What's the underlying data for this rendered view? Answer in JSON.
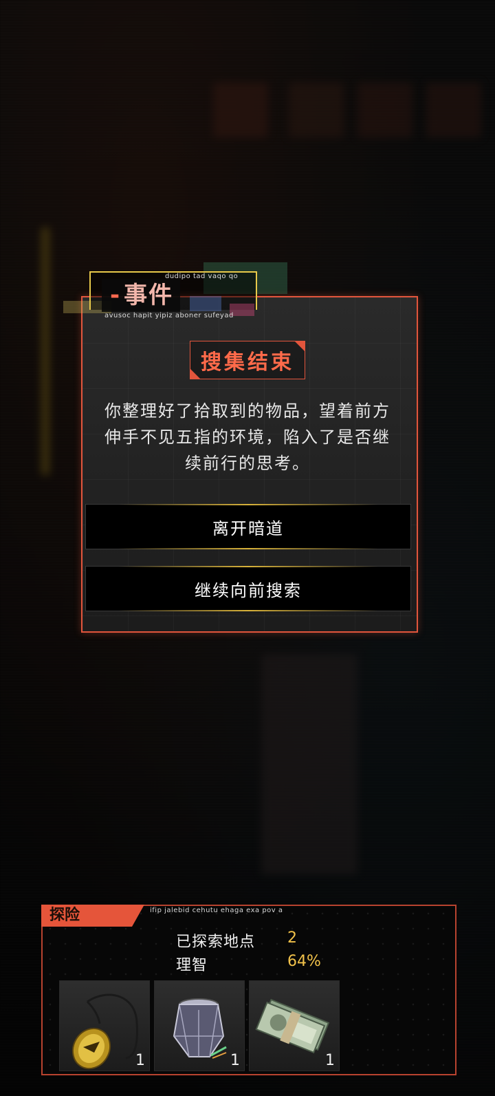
{
  "event": {
    "title": "事件",
    "title_dash": "-",
    "title_sub_top": "dudipo tad vaqo qo",
    "title_sub_bottom": "avusoc hapit yipiz aboner sufeyad",
    "heading": "搜集结束",
    "description": "你整理好了拾取到的物品，望着前方伸手不见五指的环境，陷入了是否继续前行的思考。",
    "choices": [
      {
        "label": "离开暗道"
      },
      {
        "label": "继续向前搜索"
      }
    ]
  },
  "explore": {
    "tab_label": "探险",
    "sub_label": "ifip jalebid cehutu ehaga exa pov a",
    "stats": [
      {
        "label": "已探索地点",
        "value": "2"
      },
      {
        "label": "理智",
        "value": "64%"
      }
    ],
    "items": [
      {
        "icon": "amulet-icon",
        "count": "1"
      },
      {
        "icon": "crystal-lantern-icon",
        "count": "1"
      },
      {
        "icon": "banknotes-icon",
        "count": "1"
      }
    ]
  },
  "colors": {
    "accent": "#e2553c",
    "gold": "#d8b23a",
    "value": "#f2c24a"
  }
}
